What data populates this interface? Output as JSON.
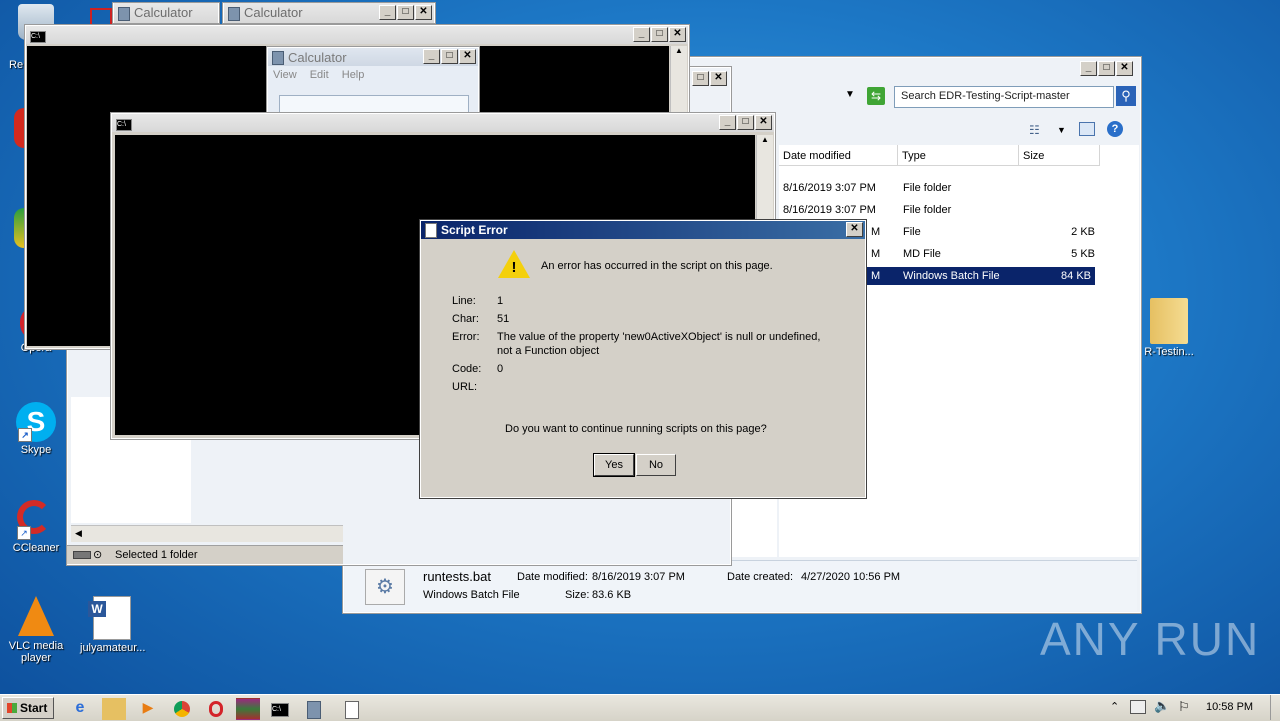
{
  "desktop": {
    "icons": [
      {
        "label": "Re"
      },
      {
        "label": "Opera"
      },
      {
        "label": "Skype"
      },
      {
        "label": "CCleaner"
      },
      {
        "label": "VLC media player"
      },
      {
        "label": "julyamateur..."
      },
      {
        "label": "R-Testin..."
      }
    ]
  },
  "calc_tabs": [
    "Calculator",
    "Calculator"
  ],
  "calc_window": {
    "title": "Calculator",
    "menu": [
      "View",
      "Edit",
      "Help"
    ]
  },
  "explorer": {
    "search_placeholder": "Search EDR-Testing-Script-master",
    "columns": [
      "Date modified",
      "Type",
      "Size"
    ],
    "rows": [
      {
        "date": "8/16/2019 3:07 PM",
        "type": "File folder",
        "size": ""
      },
      {
        "date": "8/16/2019 3:07 PM",
        "type": "File folder",
        "size": ""
      },
      {
        "date": "M",
        "type": "File",
        "size": "2 KB"
      },
      {
        "date": "M",
        "type": "MD File",
        "size": "5 KB"
      },
      {
        "date": "M",
        "type": "Windows Batch File",
        "size": "84 KB"
      }
    ],
    "status": "Selected 1 folder",
    "details": {
      "name": "runtests.bat",
      "type": "Windows Batch File",
      "date_modified_label": "Date modified:",
      "date_modified": "8/16/2019 3:07 PM",
      "size_label": "Size:",
      "size": "83.6 KB",
      "date_created_label": "Date created:",
      "date_created": "4/27/2020 10:56 PM"
    }
  },
  "dialog": {
    "title": "Script Error",
    "message": "An error has occurred in the script on this page.",
    "line_label": "Line:",
    "line": "1",
    "char_label": "Char:",
    "char": "51",
    "error_label": "Error:",
    "error_line1": "The value of the property 'new0ActiveXObject' is null or undefined,",
    "error_line2": "not a Function object",
    "code_label": "Code:",
    "code": "0",
    "url_label": "URL:",
    "url": "",
    "question": "Do you want to continue running scripts on this page?",
    "yes": "Yes",
    "no": "No"
  },
  "taskbar": {
    "start": "Start",
    "clock": "10:58 PM"
  },
  "watermark": "ANY RUN",
  "colors": {
    "dialog_title": "#0a246a",
    "selected_row": "#0a246a",
    "console": "#000000"
  }
}
